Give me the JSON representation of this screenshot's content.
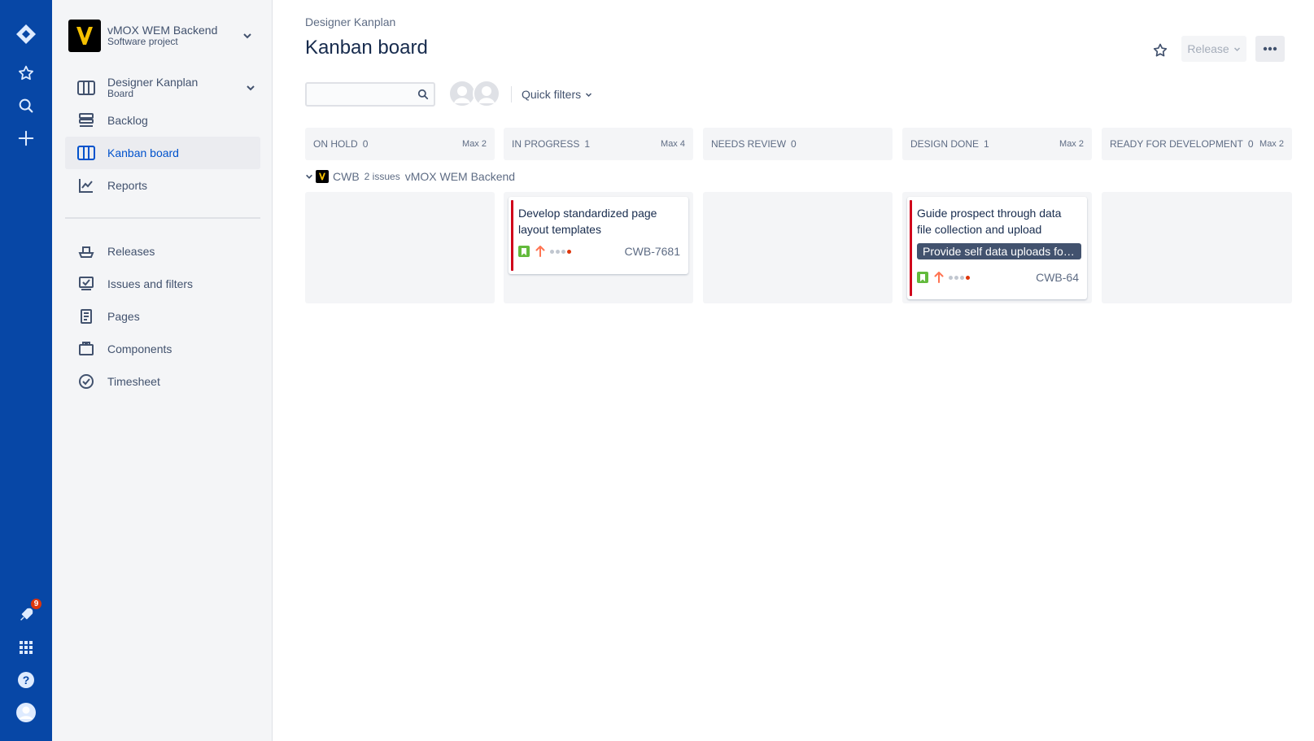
{
  "global_nav": {
    "notification_count": "9",
    "icons": [
      "jira-logo-icon",
      "star-icon",
      "search-icon",
      "plus-icon",
      "rocket-icon",
      "app-switcher-icon",
      "help-icon",
      "user-avatar-icon"
    ]
  },
  "sidebar": {
    "project_name": "vMOX WEM Backend",
    "project_type": "Software project",
    "board_name": "Designer Kanplan",
    "board_type": "Board",
    "items": [
      {
        "label": "Backlog"
      },
      {
        "label": "Kanban board"
      },
      {
        "label": "Reports"
      },
      {
        "label": "Releases"
      },
      {
        "label": "Issues and filters"
      },
      {
        "label": "Pages"
      },
      {
        "label": "Components"
      },
      {
        "label": "Timesheet"
      }
    ]
  },
  "main": {
    "breadcrumb": "Designer Kanplan",
    "title": "Kanban board",
    "release_label": "Release",
    "search_value": "",
    "quick_filters_label": "Quick filters"
  },
  "columns": [
    {
      "name": "ON HOLD",
      "count": "0",
      "max": "Max 2"
    },
    {
      "name": "IN PROGRESS",
      "count": "1",
      "max": "Max 4"
    },
    {
      "name": "NEEDS REVIEW",
      "count": "0",
      "max": ""
    },
    {
      "name": "DESIGN DONE",
      "count": "1",
      "max": "Max 2"
    },
    {
      "name": "READY FOR DEVELOPMENT",
      "count": "0",
      "max": "Max 2"
    }
  ],
  "swimlane": {
    "key": "CWB",
    "issues": "2 issues",
    "project": "vMOX WEM Backend"
  },
  "cards": [
    {
      "title": "Develop standardized page layout templates",
      "key": "CWB-7681",
      "epic": ""
    },
    {
      "title": "Guide prospect through data file collection and upload",
      "key": "CWB-64",
      "epic": "Provide self data uploads for..."
    }
  ],
  "colors": {
    "global_nav": "#0747A6",
    "accent": "#0052CC",
    "flag_red": "#D0021B",
    "story_green": "#63BA3C",
    "priority_orange": "#FF7452"
  }
}
